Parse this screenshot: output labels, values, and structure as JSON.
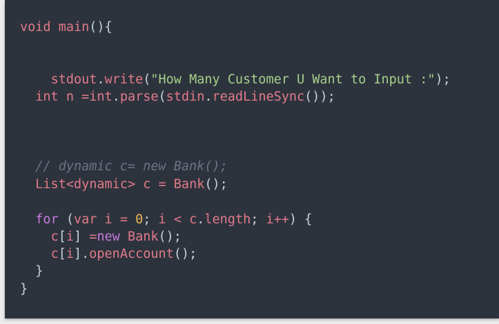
{
  "editor": {
    "lines": [
      {
        "indent": "",
        "tokens": [
          {
            "t": "void",
            "k": "kw"
          },
          {
            "t": " ",
            "k": "pl"
          },
          {
            "t": "main",
            "k": "fn"
          },
          {
            "t": "(){",
            "k": "pl"
          }
        ]
      },
      {
        "indent": "    ",
        "tokens": [
          {
            "t": "stdout",
            "k": "kw"
          },
          {
            "t": ".",
            "k": "pl"
          },
          {
            "t": "write",
            "k": "fn"
          },
          {
            "t": "(",
            "k": "pl"
          },
          {
            "t": "\"How Many Customer U Want to Input :\"",
            "k": "str"
          },
          {
            "t": ");",
            "k": "pl"
          }
        ]
      },
      {
        "indent": "  ",
        "tokens": [
          {
            "t": "int",
            "k": "kw"
          },
          {
            "t": " ",
            "k": "pl"
          },
          {
            "t": "n",
            "k": "kw"
          },
          {
            "t": " ",
            "k": "pl"
          },
          {
            "t": "=",
            "k": "op"
          },
          {
            "t": "int",
            "k": "kw"
          },
          {
            "t": ".",
            "k": "pl"
          },
          {
            "t": "parse",
            "k": "fn"
          },
          {
            "t": "(",
            "k": "pl"
          },
          {
            "t": "stdin",
            "k": "kw"
          },
          {
            "t": ".",
            "k": "pl"
          },
          {
            "t": "readLineSync",
            "k": "fn"
          },
          {
            "t": "());",
            "k": "pl"
          }
        ]
      },
      {
        "indent": "  ",
        "tokens": [
          {
            "t": "// dynamic c= new Bank();",
            "k": "com"
          }
        ]
      },
      {
        "indent": "  ",
        "tokens": [
          {
            "t": "List",
            "k": "kw"
          },
          {
            "t": "<",
            "k": "op"
          },
          {
            "t": "dynamic",
            "k": "kw"
          },
          {
            "t": ">",
            "k": "op"
          },
          {
            "t": " ",
            "k": "pl"
          },
          {
            "t": "c",
            "k": "kw"
          },
          {
            "t": " ",
            "k": "pl"
          },
          {
            "t": "=",
            "k": "op"
          },
          {
            "t": " ",
            "k": "pl"
          },
          {
            "t": "Bank",
            "k": "kw"
          },
          {
            "t": "();",
            "k": "pl"
          }
        ]
      },
      {
        "indent": "  ",
        "tokens": [
          {
            "t": "for",
            "k": "ctl"
          },
          {
            "t": " (",
            "k": "pl"
          },
          {
            "t": "var",
            "k": "kw"
          },
          {
            "t": " ",
            "k": "pl"
          },
          {
            "t": "i",
            "k": "kw"
          },
          {
            "t": " ",
            "k": "pl"
          },
          {
            "t": "=",
            "k": "op"
          },
          {
            "t": " ",
            "k": "pl"
          },
          {
            "t": "0",
            "k": "num"
          },
          {
            "t": "; ",
            "k": "pl"
          },
          {
            "t": "i",
            "k": "kw"
          },
          {
            "t": " ",
            "k": "pl"
          },
          {
            "t": "<",
            "k": "op"
          },
          {
            "t": " ",
            "k": "pl"
          },
          {
            "t": "c",
            "k": "kw"
          },
          {
            "t": ".",
            "k": "pl"
          },
          {
            "t": "length",
            "k": "kw"
          },
          {
            "t": "; ",
            "k": "pl"
          },
          {
            "t": "i",
            "k": "kw"
          },
          {
            "t": "++",
            "k": "op"
          },
          {
            "t": ") {",
            "k": "pl"
          }
        ]
      },
      {
        "indent": "    ",
        "tokens": [
          {
            "t": "c",
            "k": "kw"
          },
          {
            "t": "[",
            "k": "pl"
          },
          {
            "t": "i",
            "k": "kw"
          },
          {
            "t": "] ",
            "k": "pl"
          },
          {
            "t": "=",
            "k": "op"
          },
          {
            "t": "new",
            "k": "ctl"
          },
          {
            "t": " ",
            "k": "pl"
          },
          {
            "t": "Bank",
            "k": "kw"
          },
          {
            "t": "();",
            "k": "pl"
          }
        ]
      },
      {
        "indent": "    ",
        "tokens": [
          {
            "t": "c",
            "k": "kw"
          },
          {
            "t": "[",
            "k": "pl"
          },
          {
            "t": "i",
            "k": "kw"
          },
          {
            "t": "].",
            "k": "pl"
          },
          {
            "t": "openAccount",
            "k": "fn"
          },
          {
            "t": "();",
            "k": "pl"
          }
        ]
      },
      {
        "indent": "  ",
        "tokens": [
          {
            "t": "}",
            "k": "pl"
          }
        ]
      },
      {
        "indent": "",
        "tokens": [
          {
            "t": "}",
            "k": "pl"
          }
        ]
      }
    ]
  },
  "colors": {
    "background": "#2d333d",
    "page": "#ececec",
    "keyword": "#e27a8a",
    "control": "#c678dd",
    "string": "#a5d18a",
    "number": "#e6b450",
    "comment": "#6b7485",
    "plain": "#c9d1d9"
  }
}
